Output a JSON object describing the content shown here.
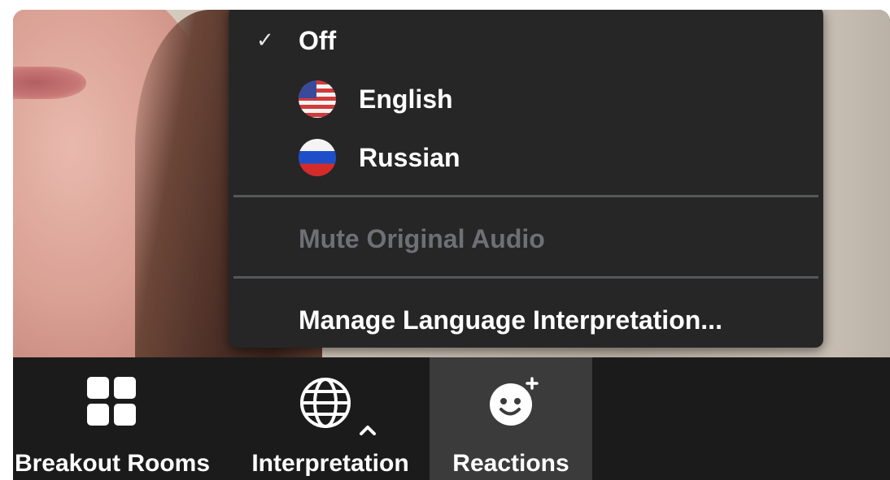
{
  "interpretation_menu": {
    "items": [
      {
        "label": "Off",
        "checked": true
      },
      {
        "label": "English",
        "flag": "us-flag-icon"
      },
      {
        "label": "Russian",
        "flag": "russia-flag-icon"
      }
    ],
    "mute_original_audio": "Mute Original Audio",
    "manage": "Manage Language Interpretation..."
  },
  "toolbar": {
    "breakout_rooms": "Breakout Rooms",
    "interpretation": "Interpretation",
    "reactions": "Reactions"
  },
  "icons": {
    "check": "✓",
    "breakout": "grid-icon",
    "interpretation": "globe-icon",
    "reactions": "smiley-plus-icon"
  },
  "colors": {
    "menu_bg": "#262627",
    "toolbar_bg": "#1b1b1c",
    "active_button_bg": "#3b3b3c",
    "disabled_text": "#6f7073"
  }
}
